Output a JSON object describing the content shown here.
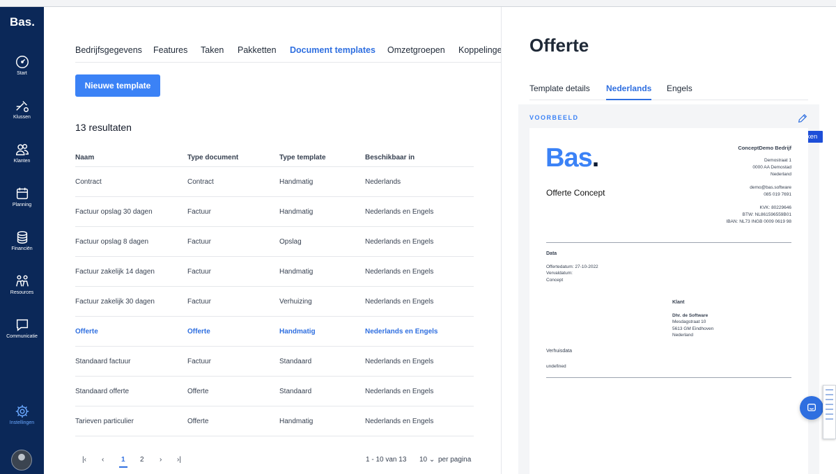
{
  "sidebar": {
    "logo": "Bas",
    "items": [
      {
        "label": "Start",
        "icon": "dashboard-icon"
      },
      {
        "label": "Klussen",
        "icon": "tools-icon"
      },
      {
        "label": "Klanten",
        "icon": "users-icon"
      },
      {
        "label": "Planning",
        "icon": "calendar-icon"
      },
      {
        "label": "Financiën",
        "icon": "coins-icon"
      },
      {
        "label": "Resources",
        "icon": "people-icon"
      },
      {
        "label": "Communicatie",
        "icon": "chat-icon"
      },
      {
        "label": "Instellingen",
        "icon": "gear-icon",
        "active": true
      }
    ]
  },
  "main": {
    "tabs": [
      "Bedrijfsgegevens",
      "Features",
      "Taken",
      "Pakketten",
      "Document templates",
      "Omzetgroepen",
      "Koppelingen"
    ],
    "active_tab": "Document templates",
    "new_button": "Nieuwe template",
    "results": "13 resultaten",
    "columns": [
      "Naam",
      "Type document",
      "Type template",
      "Beschikbaar in"
    ],
    "rows": [
      [
        "Contract",
        "Contract",
        "Handmatig",
        "Nederlands"
      ],
      [
        "Factuur opslag 30 dagen",
        "Factuur",
        "Handmatig",
        "Nederlands en Engels"
      ],
      [
        "Factuur opslag 8 dagen",
        "Factuur",
        "Opslag",
        "Nederlands en Engels"
      ],
      [
        "Factuur zakelijk 14 dagen",
        "Factuur",
        "Handmatig",
        "Nederlands en Engels"
      ],
      [
        "Factuur zakelijk 30 dagen",
        "Factuur",
        "Verhuizing",
        "Nederlands en Engels"
      ],
      [
        "Offerte",
        "Offerte",
        "Handmatig",
        "Nederlands en Engels"
      ],
      [
        "Standaard factuur",
        "Factuur",
        "Standaard",
        "Nederlands en Engels"
      ],
      [
        "Standaard offerte",
        "Offerte",
        "Standaard",
        "Nederlands en Engels"
      ],
      [
        "Tarieven particulier",
        "Offerte",
        "Handmatig",
        "Nederlands en Engels"
      ]
    ],
    "active_row": 5,
    "pagination": {
      "pages": [
        "1",
        "2"
      ],
      "current": "1",
      "range": "1 - 10 van 13",
      "per_page": "10",
      "per_page_label": "per pagina"
    }
  },
  "panel": {
    "title": "Offerte",
    "tabs": [
      "Template details",
      "Nederlands",
      "Engels"
    ],
    "active_tab": "Nederlands",
    "preview_label": "VOORBEELD",
    "edit_tooltip": "Bewerken",
    "doc": {
      "logo": "Bas",
      "title": "Offerte Concept",
      "company_name": "ConceptDemo Bedrijf",
      "address": [
        "Demostraat 1",
        "0000 AA Demostad",
        "Nederland"
      ],
      "contact": [
        "demo@bas.software",
        "085 019 7691"
      ],
      "registration": [
        "KVK: 80229646",
        "BTW:  NL861596559B01",
        "IBAN:  NL73 INGB 0009 0619 98"
      ],
      "data_heading": "Data",
      "data_lines": [
        "Offertedatum: 27-10-2022",
        "Vervaldatum:",
        "Concept"
      ],
      "client_heading": "Klant",
      "client_lines": [
        "Dhr. de Software",
        "Mesdagstraat 10",
        "5613 GM Eindhoven",
        "Nederland"
      ],
      "moving_heading": "Verhuisdata",
      "moving_value": "undefined"
    }
  }
}
